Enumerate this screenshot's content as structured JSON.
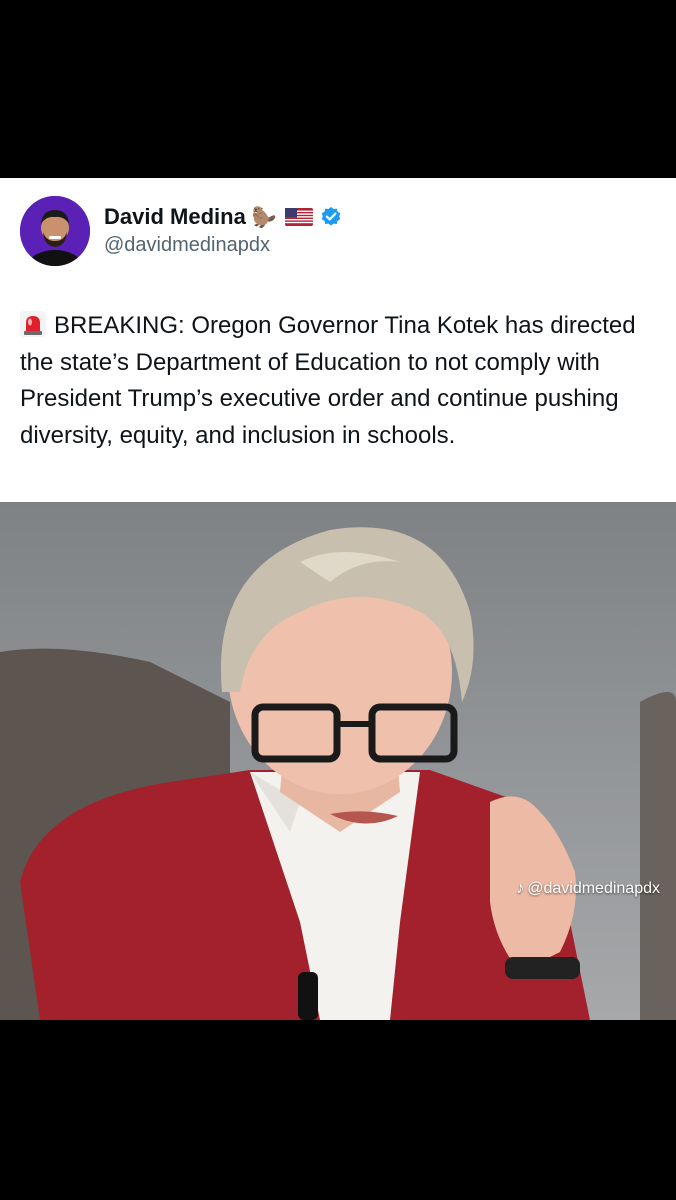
{
  "post": {
    "author": {
      "display_name": "David Medina",
      "handle": "@davidmedinapdx",
      "badge_emojis": [
        "beaver-emoji",
        "us-flag-emoji"
      ],
      "verified": true,
      "verified_color": "#1d9bf0"
    },
    "text": "BREAKING: Oregon Governor Tina Kotek has directed the state’s Department of Education to not comply with President Trump’s executive order and continue pushing diversity, equity, and inclusion in schools.",
    "text_prefix_icon": "rotating-light-emoji",
    "photo": {
      "watermark_icon": "tiktok-icon",
      "watermark_text": "@davidmedinapdx"
    }
  },
  "colors": {
    "background": "#000000",
    "card": "#ffffff",
    "text": "#0f1419",
    "handle": "#536471",
    "blazer": "#a3212c"
  }
}
